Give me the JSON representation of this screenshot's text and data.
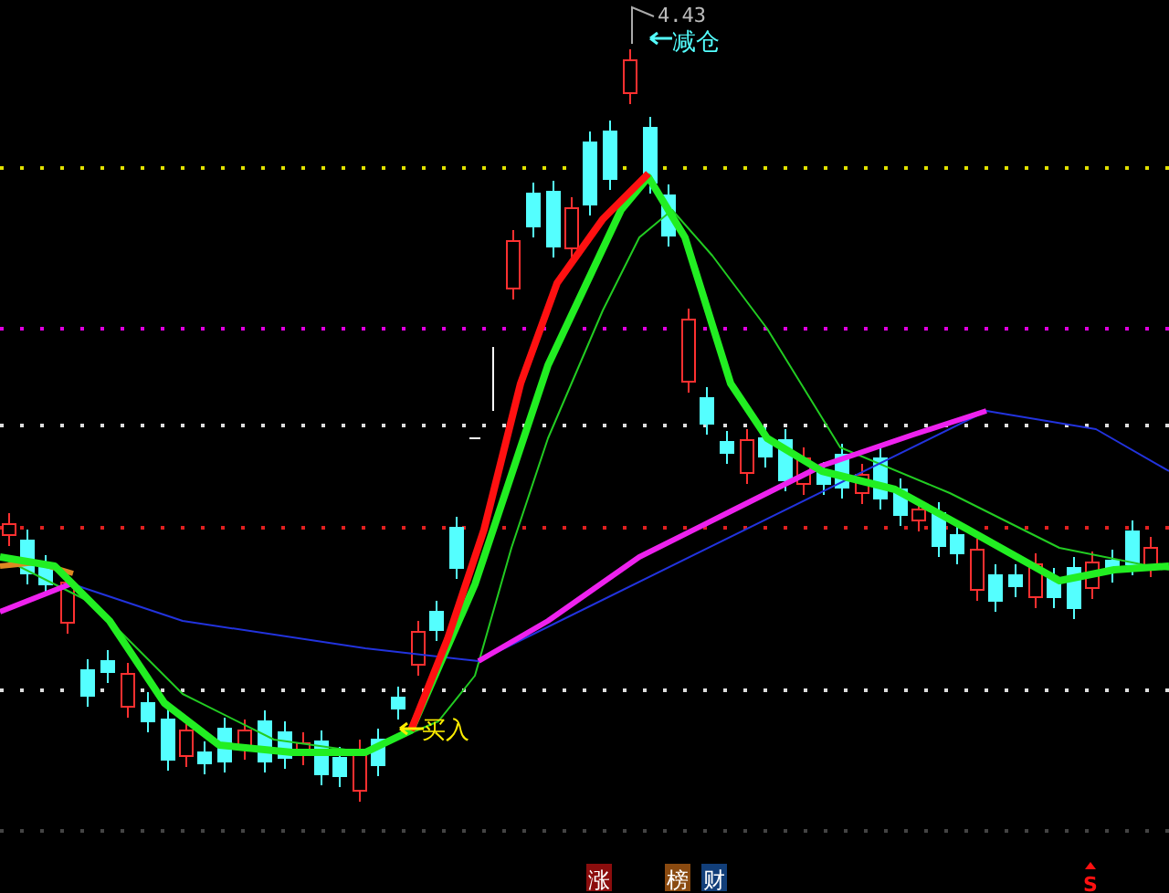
{
  "annotations": [
    {
      "kind": "high",
      "text": "4.43"
    },
    {
      "kind": "sell",
      "text": "减仓"
    },
    {
      "kind": "buy",
      "text": "买入"
    }
  ],
  "badges": [
    {
      "text": "涨",
      "color": "#8b0d0d"
    },
    {
      "text": "榜",
      "color": "#8a4a10"
    },
    {
      "text": "财",
      "color": "#123f7a"
    }
  ],
  "signal": {
    "text": "S"
  }
}
